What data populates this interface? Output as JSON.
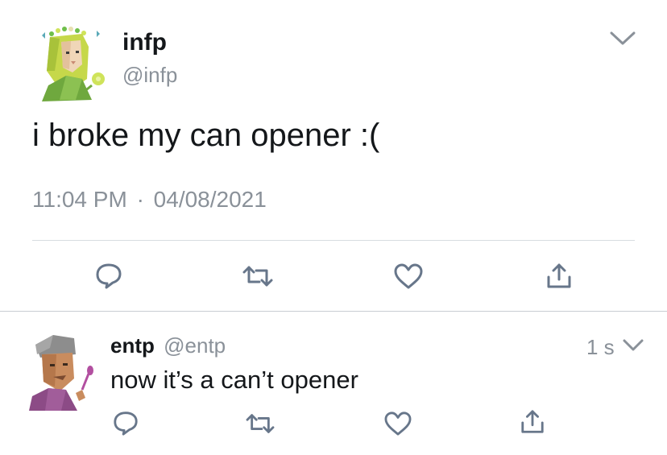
{
  "main_tweet": {
    "display_name": "infp",
    "handle": "@infp",
    "text": "i broke my can opener :(",
    "time": "11:04 PM",
    "separator": "·",
    "date": "04/08/2021",
    "avatar_icon": "infp-character-avatar",
    "menu_icon": "chevron-down-icon"
  },
  "main_actions": [
    {
      "icon": "reply-icon"
    },
    {
      "icon": "retweet-icon"
    },
    {
      "icon": "like-icon"
    },
    {
      "icon": "share-icon"
    }
  ],
  "reply_tweet": {
    "display_name": "entp",
    "handle": "@entp",
    "text": "now it’s a can’t opener",
    "timestamp": "1 s",
    "avatar_icon": "entp-character-avatar",
    "menu_icon": "chevron-down-icon"
  },
  "reply_actions": [
    {
      "icon": "reply-icon"
    },
    {
      "icon": "retweet-icon"
    },
    {
      "icon": "like-icon"
    },
    {
      "icon": "share-icon"
    }
  ],
  "colors": {
    "text": "#14171a",
    "muted": "#8a9199",
    "icon": "#67768a",
    "divider": "#d8dde1"
  }
}
